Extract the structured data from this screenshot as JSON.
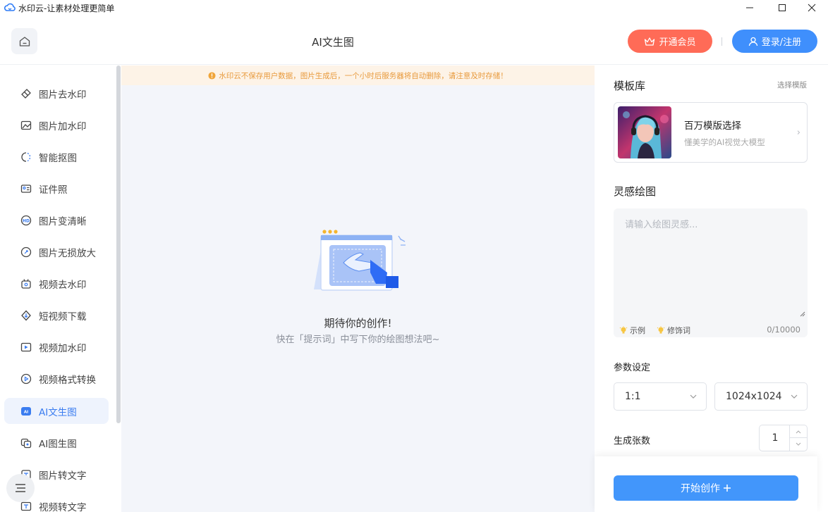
{
  "window": {
    "title": "水印云-让素材处理更简单"
  },
  "header": {
    "page_title": "AI文生图",
    "vip_label": "开通会员",
    "login_label": "登录/注册"
  },
  "sidebar": {
    "items": [
      {
        "label": "图片去水印",
        "icon": "eraser-icon"
      },
      {
        "label": "图片加水印",
        "icon": "image-add-icon"
      },
      {
        "label": "智能抠图",
        "icon": "cutout-icon"
      },
      {
        "label": "证件照",
        "icon": "id-card-icon"
      },
      {
        "label": "图片变清晰",
        "icon": "hd-icon"
      },
      {
        "label": "图片无损放大",
        "icon": "zoom-expand-icon"
      },
      {
        "label": "视频去水印",
        "icon": "video-eraser-icon"
      },
      {
        "label": "短视频下载",
        "icon": "download-icon"
      },
      {
        "label": "视频加水印",
        "icon": "video-add-icon"
      },
      {
        "label": "视频格式转换",
        "icon": "convert-icon"
      },
      {
        "label": "AI文生图",
        "icon": "ai-text-image-icon",
        "active": true
      },
      {
        "label": "AI图生图",
        "icon": "ai-image-image-icon"
      },
      {
        "label": "图片转文字",
        "icon": "ocr-icon"
      },
      {
        "label": "视频转文字",
        "icon": "video-text-icon"
      }
    ]
  },
  "main": {
    "notice": "水印云不保存用户数据，图片生成后，一个小时后服务器将自动删除，请注意及时存储！",
    "empty_title": "期待你的创作!",
    "empty_subtitle": "快在「提示词」中写下你的绘图想法吧~"
  },
  "panel": {
    "template_section": "模板库",
    "template_link": "选择模版",
    "template_card": {
      "name": "百万模版选择",
      "desc": "懂美学的AI视觉大模型"
    },
    "inspiration_section": "灵感绘图",
    "prompt_placeholder": "请输入绘图灵感...",
    "example_label": "示例",
    "modifier_label": "修饰词",
    "char_count": "0/10000",
    "params_section": "参数设定",
    "ratio_value": "1:1",
    "size_value": "1024x1024",
    "quantity_label": "生成张数",
    "quantity_value": "1",
    "start_label": "开始创作"
  },
  "colors": {
    "primary": "#4296fb",
    "vip": "#ff6b57",
    "active_bg": "#eef3fd",
    "notice_text": "#e89a3c"
  }
}
